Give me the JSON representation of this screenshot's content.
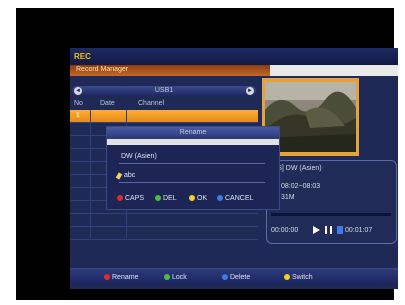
{
  "app": {
    "title": "REC",
    "subtitle": "Record Manager"
  },
  "browser": {
    "device_label": "USB1",
    "left_arrow": "◄",
    "right_arrow": "►",
    "columns": [
      "No",
      "Date",
      "Channel"
    ],
    "rows": [
      {
        "no": "1",
        "selected": true
      }
    ]
  },
  "info": {
    "channel": "[TS] DW (Asien)",
    "time_range": "08:02~08:03",
    "size": "31M",
    "time_start": "00:00:00",
    "time_end": "00:01:07",
    "progress_fraction": 0.0
  },
  "dialog": {
    "title": "Rename",
    "field_label": "DW (Asien)",
    "input_value": "abc",
    "actions": [
      {
        "label": "CAPS",
        "color": "#e02a2a"
      },
      {
        "label": "DEL",
        "color": "#4cbe3a"
      },
      {
        "label": "OK",
        "color": "#f2d21a"
      },
      {
        "label": "CANCEL",
        "color": "#3f7be8"
      }
    ]
  },
  "footer": {
    "actions": [
      {
        "label": "Rename",
        "color": "#e02a2a"
      },
      {
        "label": "Lock",
        "color": "#4cbe3a"
      },
      {
        "label": "Delete",
        "color": "#3f7be8"
      },
      {
        "label": "Switch",
        "color": "#f2d21a"
      }
    ]
  }
}
